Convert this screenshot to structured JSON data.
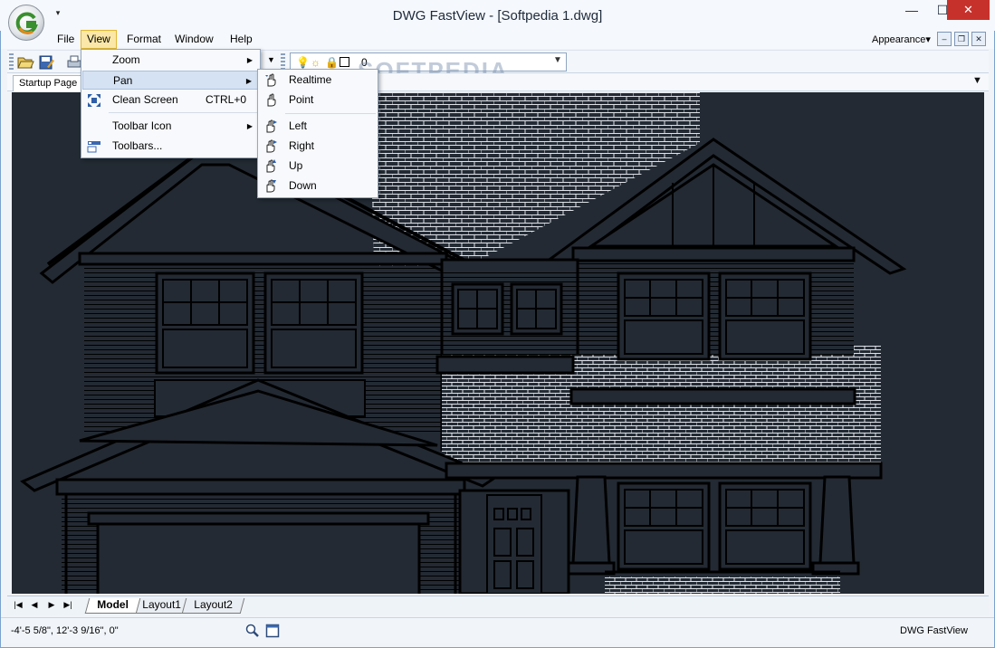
{
  "window": {
    "title": "DWG FastView - [Softpedia 1.dwg]",
    "minimize": "—",
    "maximize": "☐",
    "close": "✕",
    "qat_arrow": "▾"
  },
  "menubar": {
    "items": [
      {
        "id": "file",
        "label": "File"
      },
      {
        "id": "view",
        "label": "View"
      },
      {
        "id": "format",
        "label": "Format"
      },
      {
        "id": "window",
        "label": "Window"
      },
      {
        "id": "help",
        "label": "Help"
      }
    ],
    "appearance": "Appearance▾",
    "mdi_min": "–",
    "mdi_restore": "❐",
    "mdi_close": "✕"
  },
  "toolbar": {
    "layer_value": "0",
    "watermark": "SOFTPEDIA"
  },
  "tabs": {
    "startup": "Startup Page",
    "dropdown": "▼"
  },
  "view_menu": {
    "items": [
      {
        "label": "Zoom",
        "submenu": true
      },
      {
        "label": "Pan",
        "submenu": true,
        "highlighted": true
      },
      {
        "label": "Clean Screen",
        "shortcut": "CTRL+0"
      },
      {
        "label": "Toolbar Icon",
        "submenu": true
      },
      {
        "label": "Toolbars..."
      }
    ],
    "submenu_arrow": "▶"
  },
  "pan_menu": {
    "items": [
      {
        "label": "Realtime"
      },
      {
        "label": "Point"
      },
      {
        "label": "Left"
      },
      {
        "label": "Right"
      },
      {
        "label": "Up"
      },
      {
        "label": "Down"
      }
    ]
  },
  "layout_tabs": {
    "nav": [
      "|◀",
      "◀",
      "▶",
      "▶|"
    ],
    "tabs": [
      "Model",
      "Layout1",
      "Layout2"
    ]
  },
  "status": {
    "coords": "-4'-5 5/8\", 12'-3 9/16\", 0\"",
    "app": "DWG FastView"
  },
  "colors": {
    "canvas": "#232a33",
    "line": "#000000",
    "menu_highlight": "#d5e2f3",
    "close_button": "#c7312b"
  }
}
